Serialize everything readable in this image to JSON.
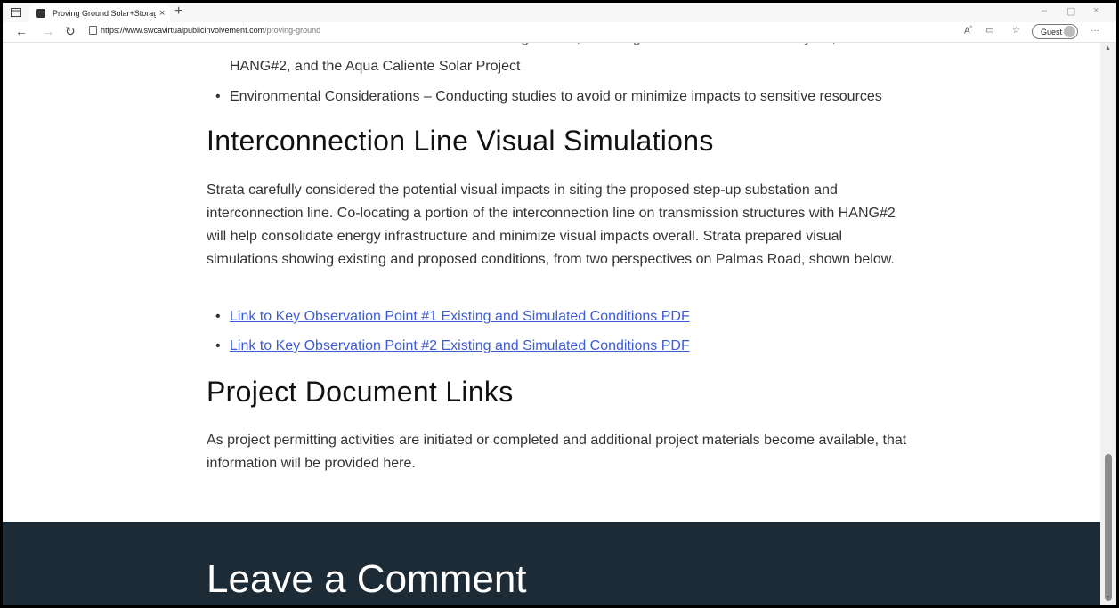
{
  "browser": {
    "tab_title": "Proving Ground Solar+Storage P",
    "tab_close": "×",
    "new_tab": "+",
    "url_host": "https://www.swcavirtualpublicinvolvement.com",
    "url_path": "/proving-ground",
    "guest_label": "Guest",
    "minimize": "–",
    "restore": "▢",
    "close": "×",
    "more": "···"
  },
  "content": {
    "bullet_partial_top": "Infrastructure – Located in an area with existing utilities, including the Hoodoo Wash Switchyard,",
    "bullet_partial_line2": "HANG#2, and the Aqua Caliente Solar Project",
    "bullet_env": "Environmental Considerations – Conducting studies to avoid or minimize impacts to sensitive resources",
    "heading_visual": "Interconnection Line Visual Simulations",
    "para_visual": "Strata carefully considered the potential visual impacts in siting the proposed step-up substation and interconnection line. Co-locating a portion of the interconnection line on transmission structures with HANG#2 will help consolidate energy infrastructure and minimize visual impacts overall. Strata prepared visual simulations showing existing and proposed conditions, from two perspectives on Palmas Road, shown below.",
    "link1": "Link to Key Observation Point #1 Existing and Simulated Conditions PDF",
    "link2": "Link to Key Observation Point #2 Existing and Simulated Conditions PDF",
    "heading_docs": "Project Document Links",
    "para_docs": "As project permitting activities are initiated or completed and additional project materials become available, that information will be provided here.",
    "footer_heading": "Leave a Comment",
    "bullet_char": "•"
  }
}
